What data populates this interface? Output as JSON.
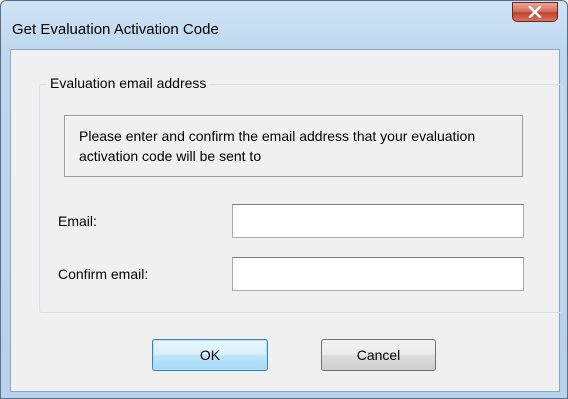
{
  "window": {
    "title": "Get Evaluation Activation Code"
  },
  "icons": {
    "close": "close-icon"
  },
  "group": {
    "label": "Evaluation email address",
    "info_text": "Please enter and confirm the email address that your evaluation activation code will be sent to"
  },
  "form": {
    "email_label": "Email:",
    "email_value": "",
    "confirm_label": "Confirm email:",
    "confirm_value": ""
  },
  "buttons": {
    "ok_label": "OK",
    "cancel_label": "Cancel"
  },
  "colors": {
    "frame": "#b9d3ed",
    "close_button": "#c7452d",
    "dialog_background": "#f0f0f0",
    "default_button_border": "#3c7fb1"
  }
}
